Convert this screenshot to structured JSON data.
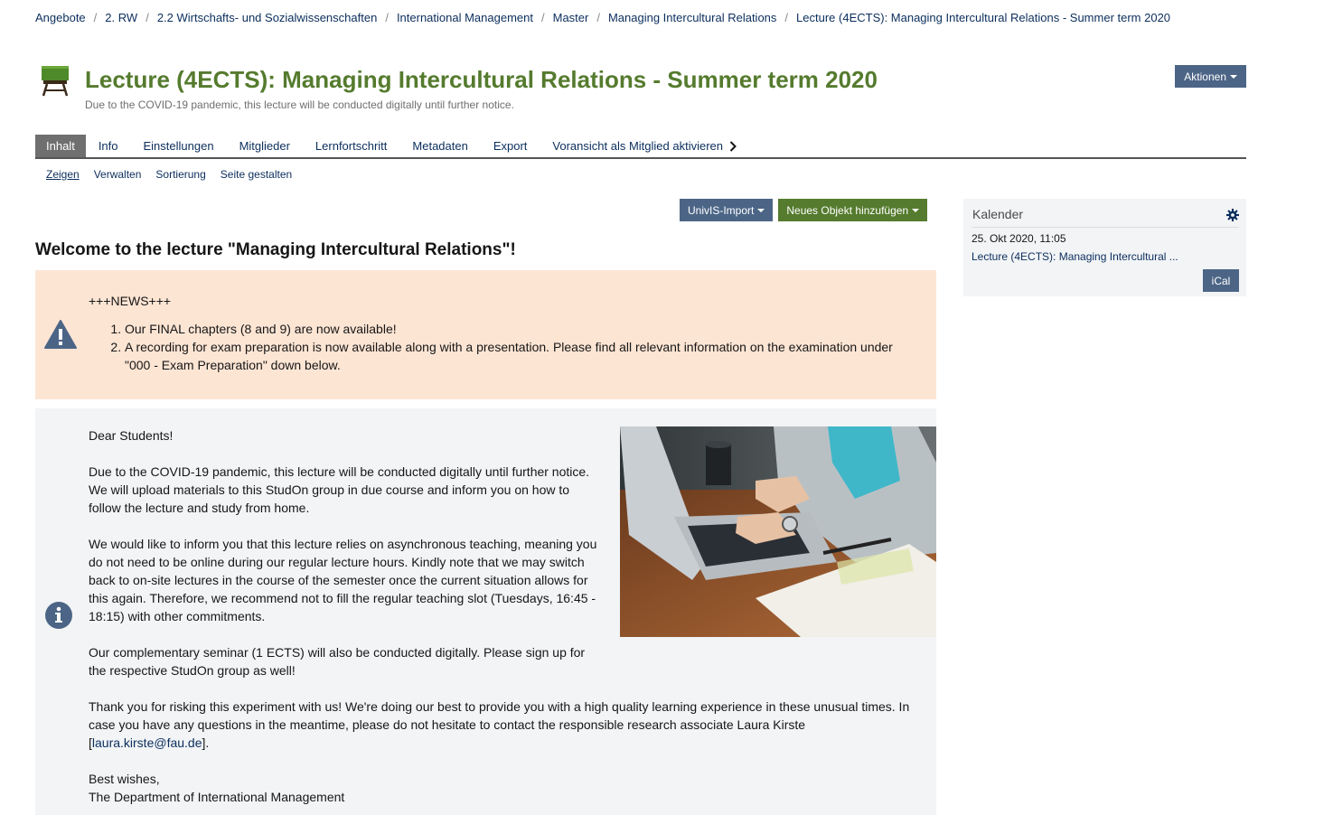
{
  "breadcrumb": [
    "Angebote",
    "2. RW",
    "2.2 Wirtschafts- und Sozialwissenschaften",
    "International Management",
    "Master",
    "Managing Intercultural Relations",
    "Lecture (4ECTS): Managing Intercultural Relations - Summer term 2020"
  ],
  "breadcrumb_separator": "/",
  "header": {
    "icon": "course-icon",
    "title": "Lecture (4ECTS): Managing Intercultural Relations - Summer term 2020",
    "description": "Due to the COVID-19 pandemic, this lecture will be conducted digitally until further notice.",
    "actions_label": "Aktionen"
  },
  "tabs": [
    {
      "label": "Inhalt",
      "active": true
    },
    {
      "label": "Info"
    },
    {
      "label": "Einstellungen"
    },
    {
      "label": "Mitglieder"
    },
    {
      "label": "Lernfortschritt"
    },
    {
      "label": "Metadaten"
    },
    {
      "label": "Export"
    },
    {
      "label": "Voransicht als Mitglied aktivieren"
    }
  ],
  "subtabs": [
    {
      "label": "Zeigen",
      "active": true
    },
    {
      "label": "Verwalten"
    },
    {
      "label": "Sortierung"
    },
    {
      "label": "Seite gestalten"
    }
  ],
  "toolbar": {
    "univis_label": "UnivIS-Import",
    "add_object_label": "Neues Objekt hinzufügen"
  },
  "welcome_heading": "Welcome to the lecture \"Managing Intercultural Relations\"!",
  "news": {
    "icon": "warning-icon",
    "heading": "+++NEWS+++",
    "items": [
      "Our FINAL chapters (8 and 9) are now available!",
      "A recording for exam preparation is now available along with a presentation. Please find all relevant information on the examination under \"000 - Exam Preparation\" down below."
    ]
  },
  "info": {
    "icon": "info-icon",
    "greeting": "Dear Students!",
    "p1": "Due to the COVID-19 pandemic, this lecture will be conducted digitally until further notice. We will upload materials to this StudOn group in due course and inform you on how to follow the lecture and study from home.",
    "p2": "We would like to inform you that this lecture relies on asynchronous teaching, meaning you do not need to be online during our regular lecture hours. Kindly note that we may switch back to on-site lectures in the course of the semester once the current situation allows for this again. Therefore, we recommend not to fill the regular teaching slot (Tuesdays, 16:45 - 18:15) with other commitments.",
    "p3": "Our complementary seminar (1 ECTS) will also be conducted digitally. Please sign up for the respective StudOn group as well!",
    "p4_text": "Thank you for risking this experiment with us! We're doing our best to provide you with a high quality learning experience in these unusual times. In case you have any questions in the meantime, please do not hesitate to contact the responsible research associate Laura Kirste [",
    "p4_email": "laura.kirste@fau.de",
    "p4_end": "].",
    "closing": "Best wishes,",
    "signature": "The Department of International Management"
  },
  "calendar": {
    "title": "Kalender",
    "date": "25. Okt 2020, 11:05",
    "event": "Lecture (4ECTS): Managing Intercultural ...",
    "ical_label": "iCal"
  },
  "colors": {
    "title_green": "#557b2e",
    "button_blue": "#4c6586",
    "button_green": "#557b2e",
    "news_bg": "#fde5d4",
    "info_bg": "#f2f4f6",
    "link": "#0b2e5c"
  }
}
